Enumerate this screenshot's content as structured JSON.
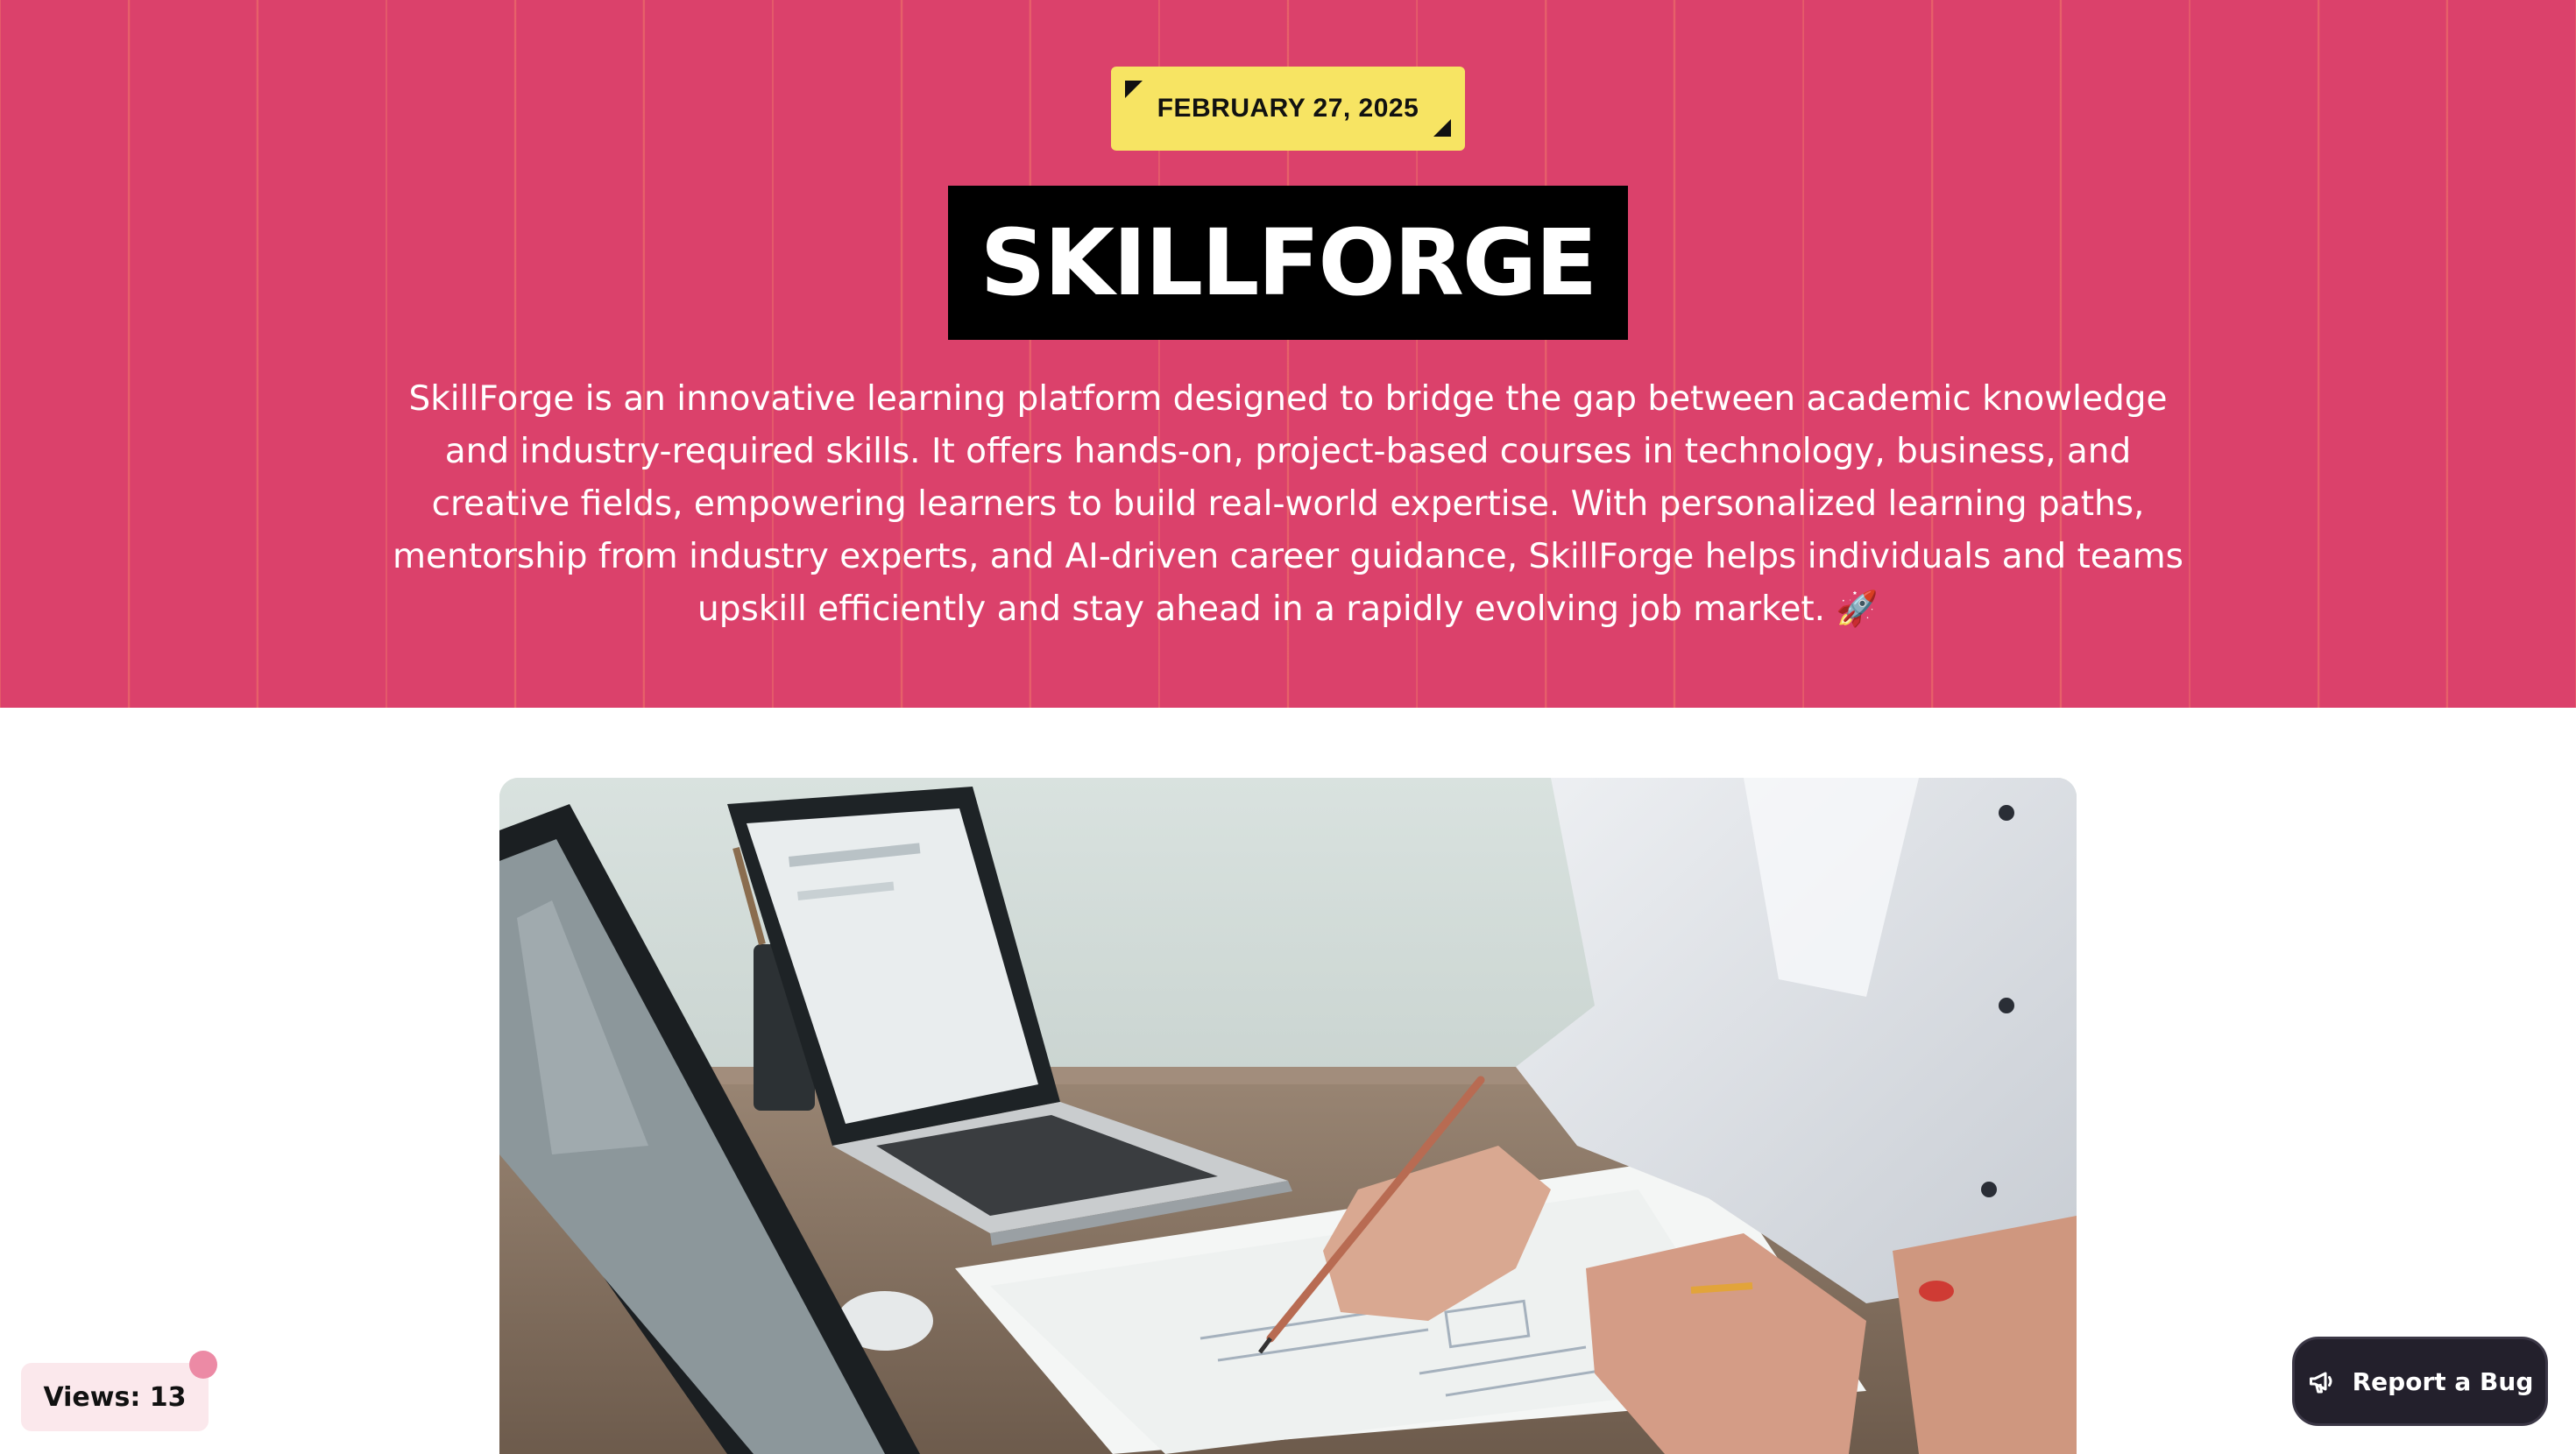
{
  "header": {
    "date": "FEBRUARY 27, 2025",
    "title": "SKILLFORGE",
    "description": "SkillForge is an innovative learning platform designed to bridge the gap between academic knowledge and industry-required skills. It offers hands-on, project-based courses in technology, business, and creative fields, empowering learners to build real-world expertise. With personalized learning paths, mentorship from industry experts, and AI-driven career guidance, SkillForge helps individuals and teams upskill efficiently and stay ahead in a rapidly evolving job market. 🚀"
  },
  "views": {
    "label": "Views: 13"
  },
  "report_button": {
    "label": "Report a Bug",
    "icon": "megaphone-icon"
  },
  "colors": {
    "hero_background": "#db416b",
    "hero_stripes": "#f17c68",
    "date_badge": "#f7e463",
    "title_box": "#000000",
    "report_button": "#23202c",
    "views_badge": "#fbe8ec",
    "views_dot": "#ec8aa5"
  }
}
